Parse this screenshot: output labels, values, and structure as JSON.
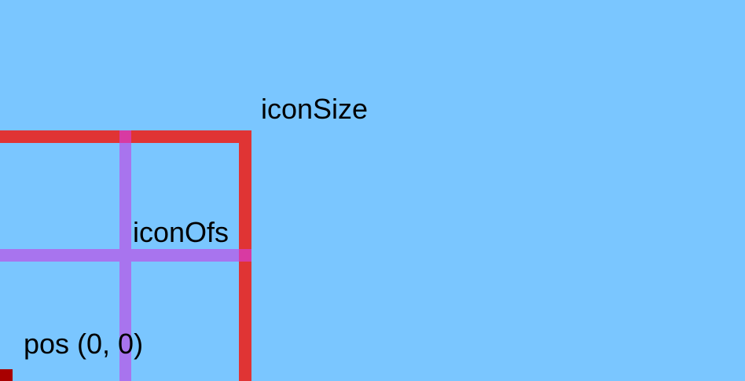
{
  "labels": {
    "icon_size": "iconSize",
    "icon_ofs": "iconOfs",
    "pos": "pos (0, 0)"
  },
  "colors": {
    "background": "#7ac6ff",
    "icon_size_box": "#e03434",
    "icon_ofs_guides": "#a874ee",
    "overlap": "#d83aa2",
    "pos_marker": "#a80000",
    "text": "#000000"
  }
}
